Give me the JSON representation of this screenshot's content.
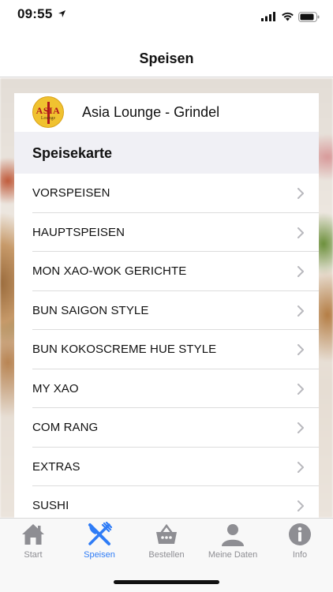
{
  "status_bar": {
    "time": "09:55"
  },
  "nav": {
    "title": "Speisen"
  },
  "restaurant": {
    "name": "Asia Lounge - Grindel",
    "logo_text": "ASIA",
    "logo_sub": "Lounge"
  },
  "menu": {
    "section_title": "Speisekarte",
    "items": [
      {
        "label": "VORSPEISEN"
      },
      {
        "label": "HAUPTSPEISEN"
      },
      {
        "label": "MON XAO-WOK GERICHTE"
      },
      {
        "label": "BUN SAIGON STYLE"
      },
      {
        "label": "BUN KOKOSCREME HUE STYLE"
      },
      {
        "label": "MY XAO"
      },
      {
        "label": "COM RANG"
      },
      {
        "label": "EXTRAS"
      },
      {
        "label": "SUSHI"
      }
    ]
  },
  "tab_bar": {
    "tabs": [
      {
        "label": "Start",
        "icon": "house-icon"
      },
      {
        "label": "Speisen",
        "icon": "fork-knife-icon"
      },
      {
        "label": "Bestellen",
        "icon": "basket-icon"
      },
      {
        "label": "Meine Daten",
        "icon": "person-icon"
      },
      {
        "label": "Info",
        "icon": "info-icon"
      }
    ],
    "active_tab": "Speisen"
  },
  "colors": {
    "accent": "#2f7cf6",
    "inactive": "#8e8e93",
    "section_bg": "#f0f0f5"
  }
}
